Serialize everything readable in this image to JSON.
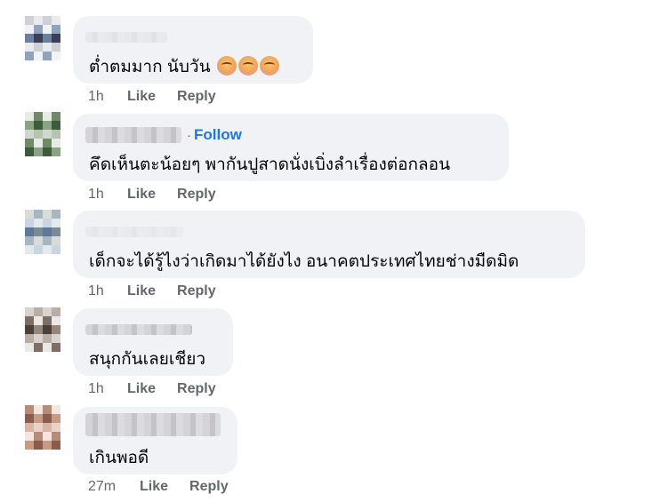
{
  "comments": [
    {
      "text": "ต่ำตมมาก นับวัน",
      "emoji_icon": "exhausted-face-emoji",
      "emoji_count": 3,
      "time": "1h",
      "like": "Like",
      "reply": "Reply",
      "avatar_colors": [
        "#e9e9ee",
        "#8fa3bd",
        "#3b3f55",
        "#cfcfd6",
        "#f2f2f5",
        "#6b7fa0"
      ]
    },
    {
      "follow": "Follow",
      "separator": "·",
      "text": "คึดเห็นตะน้อยๆ พากันปูสาดนั่งเบิ่งลำเรื่องต่อกลอน",
      "time": "1h",
      "like": "Like",
      "reply": "Reply",
      "avatar_colors": [
        "#cfd8cc",
        "#6e8a66",
        "#3f5b3d",
        "#b7c3b1",
        "#e6ece3",
        "#8aa384"
      ]
    },
    {
      "text": "เด็กจะได้รู้ไงว่าเกิดมาได้ยังไง อนาคตประเทศไทยช่างมืดมิด",
      "time": "1h",
      "like": "Like",
      "reply": "Reply",
      "avatar_colors": [
        "#c9d5e0",
        "#5e7897",
        "#a8b6c2",
        "#e4e9ee",
        "#7b8a93",
        "#d9dcd9"
      ]
    },
    {
      "text": "สนุกกันเลยเชียว",
      "time": "1h",
      "like": "Like",
      "reply": "Reply",
      "avatar_colors": [
        "#d8d3cf",
        "#7d6f66",
        "#4a3f3a",
        "#b9aea6",
        "#ece8e5",
        "#95877c"
      ]
    },
    {
      "text": "เกินพอดี",
      "time": "27m",
      "like": "Like",
      "reply": "Reply",
      "avatar_colors": [
        "#e7d3c9",
        "#b88b78",
        "#8a5c4d",
        "#d8b6a6",
        "#f3e6df",
        "#c79a86"
      ]
    }
  ],
  "colors": {
    "bubble": "#f0f2f5",
    "text": "#050505",
    "meta": "#65676b",
    "follow": "#1877f2"
  }
}
